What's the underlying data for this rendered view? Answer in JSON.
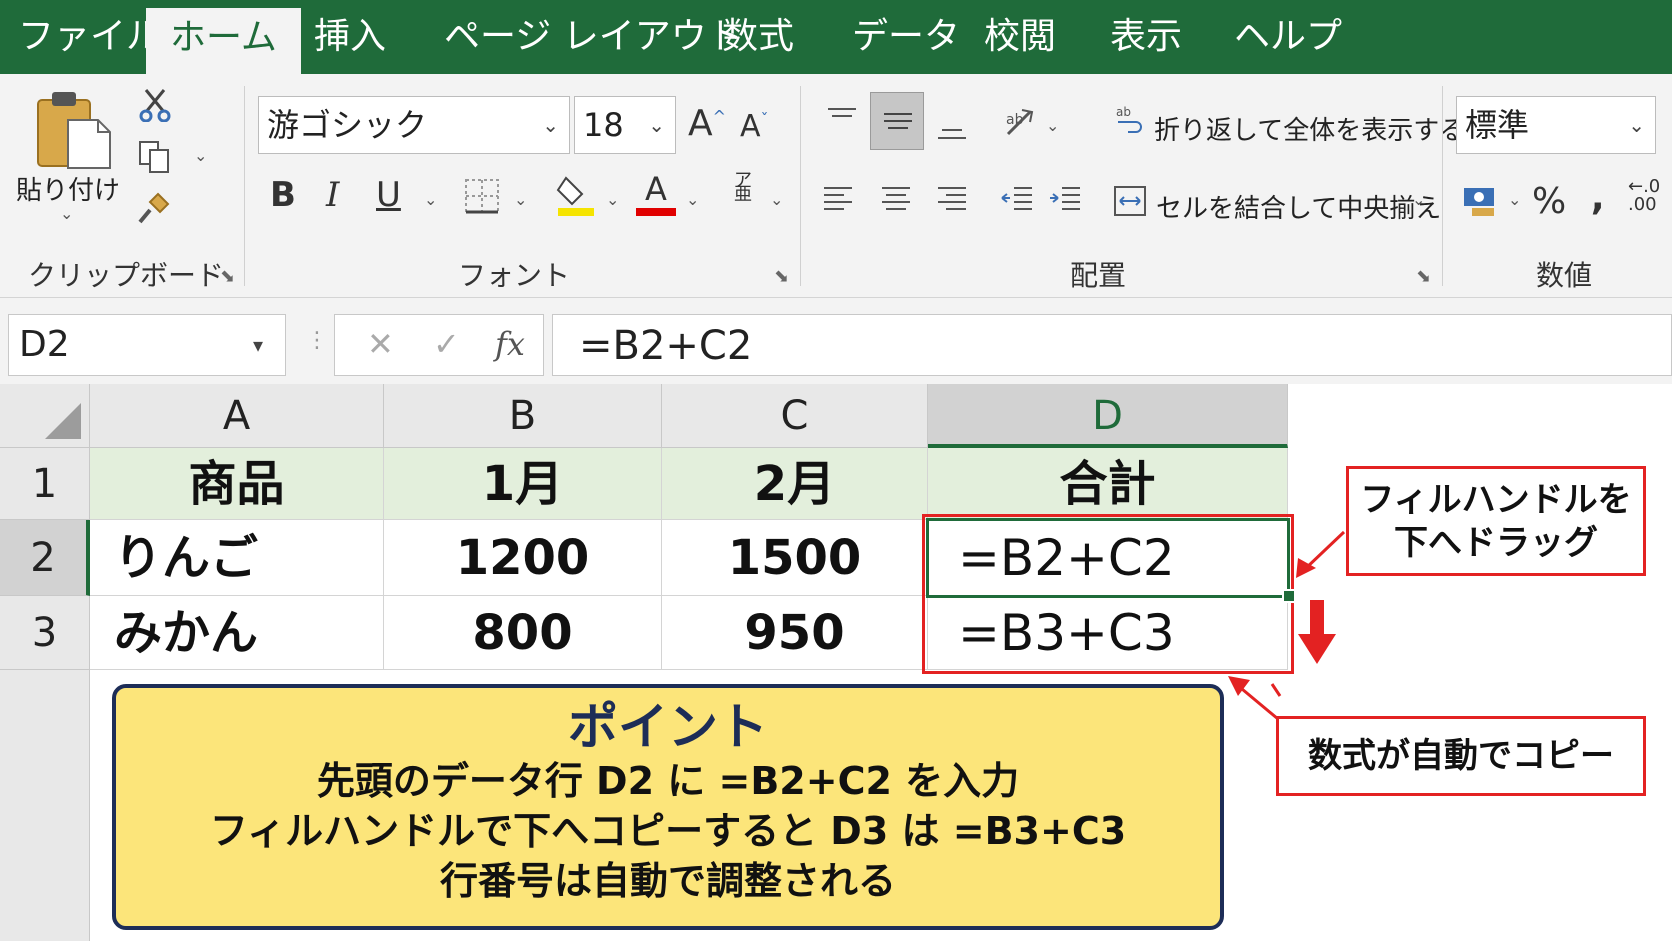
{
  "menu": {
    "tabs": [
      "ファイル",
      "ホーム",
      "挿入",
      "ページ レイアウト",
      "数式",
      "データ",
      "校閲",
      "表示",
      "ヘルプ"
    ],
    "active": "ホーム"
  },
  "ribbon": {
    "clipboard": {
      "paste_label": "貼り付け",
      "group_label": "クリップボード"
    },
    "font": {
      "name": "游ゴシック",
      "size": "18",
      "group_label": "フォント",
      "bold": "B",
      "italic": "I",
      "underline": "U",
      "fill_color": "#f5e400",
      "font_color": "#e00000",
      "font_color_letter": "A",
      "grow_label": "A",
      "shrink_label": "A"
    },
    "alignment": {
      "wrap_text_label": "折り返して全体を表示する",
      "merge_label": "セルを結合して中央揃え",
      "group_label": "配置"
    },
    "number": {
      "format": "標準",
      "percent": "%",
      "comma": "‚",
      "group_label": "数値",
      "decimal_top": "←.0",
      "decimal_bottom": ".00"
    }
  },
  "formula_bar": {
    "name_box": "D2",
    "cancel": "✕",
    "enter": "✓",
    "fx": "fx",
    "formula": "=B2+C2"
  },
  "sheet": {
    "columns": [
      "A",
      "B",
      "C",
      "D"
    ],
    "rows": [
      "1",
      "2",
      "3"
    ],
    "header_row": [
      "商品",
      "1月",
      "2月",
      "合計"
    ],
    "data": [
      [
        "りんご",
        "1200",
        "1500",
        "=B2+C2"
      ],
      [
        "みかん",
        "800",
        "950",
        "=B3+C3"
      ]
    ],
    "active_cell": "D2",
    "accent": "#1f6b3a",
    "header_fill": "#e3efdc"
  },
  "annotations": {
    "fill_handle_callout": [
      "フィルハンドルを",
      "下へドラッグ"
    ],
    "copy_callout": "数式が自動でコピー",
    "point_title": "ポイント",
    "point_lines": [
      "先頭のデータ行 D2 に =B2+C2 を入力",
      "フィルハンドルで下へコピーすると D3 は =B3+C3",
      "行番号は自動で調整される"
    ],
    "highlight_color": "#e32222",
    "point_fill": "#fce57a"
  }
}
